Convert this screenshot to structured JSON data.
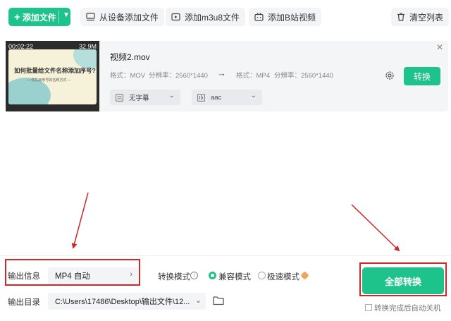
{
  "toolbar": {
    "add_file": "添加文件",
    "from_device": "从设备添加文件",
    "add_m3u8": "添加m3u8文件",
    "add_bilibili": "添加B站视频",
    "clear_list": "清空列表"
  },
  "file": {
    "thumb_time": "00:02:22",
    "thumb_size": "32.9M",
    "thumb_title": "如何批量给文件名称添加序号?",
    "thumb_sub": "— 优先级序号的名称方式 —",
    "name": "视频2.mov",
    "src_format": "格式：MOV",
    "src_resolution": "分辨率：2560*1440",
    "dst_format": "格式：MP4",
    "dst_resolution": "分辨率：2560*1440",
    "subtitle": "无字幕",
    "audio": "aac",
    "convert": "转换"
  },
  "bottom": {
    "output_info_label": "输出信息",
    "output_info_value": "MP4 自动",
    "mode_label": "转换模式",
    "mode_compatible": "兼容模式",
    "mode_fast": "极速模式",
    "output_dir_label": "输出目录",
    "output_dir_value": "C:\\Users\\17486\\Desktop\\输出文件\\12...",
    "convert_all": "全部转换",
    "shutdown_label": "转换完成后自动关机"
  },
  "colors": {
    "accent": "#1ec28b",
    "annotation": "#d0282a"
  }
}
